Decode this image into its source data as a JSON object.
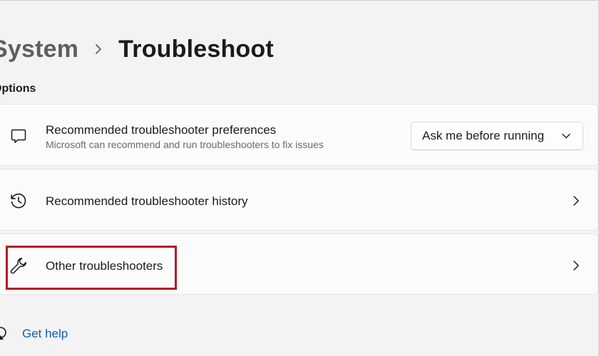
{
  "header": {
    "parent": "System",
    "current": "Troubleshoot"
  },
  "section": {
    "label": "Options"
  },
  "cards": [
    {
      "title": "Recommended troubleshooter preferences",
      "subtitle": "Microsoft can recommend and run troubleshooters to fix issues",
      "icon": "chat-bubble-icon",
      "dropdown": {
        "selected": "Ask me before running"
      }
    },
    {
      "title": "Recommended troubleshooter history",
      "icon": "history-icon"
    },
    {
      "title": "Other troubleshooters",
      "icon": "wrench-icon",
      "highlighted": true
    }
  ],
  "footer": {
    "get_help": "Get help",
    "icon": "help-icon"
  },
  "colors": {
    "background": "#f3f3f3",
    "card": "#fbfbfb",
    "link": "#0a5fb4",
    "highlight": "#b01e23"
  }
}
